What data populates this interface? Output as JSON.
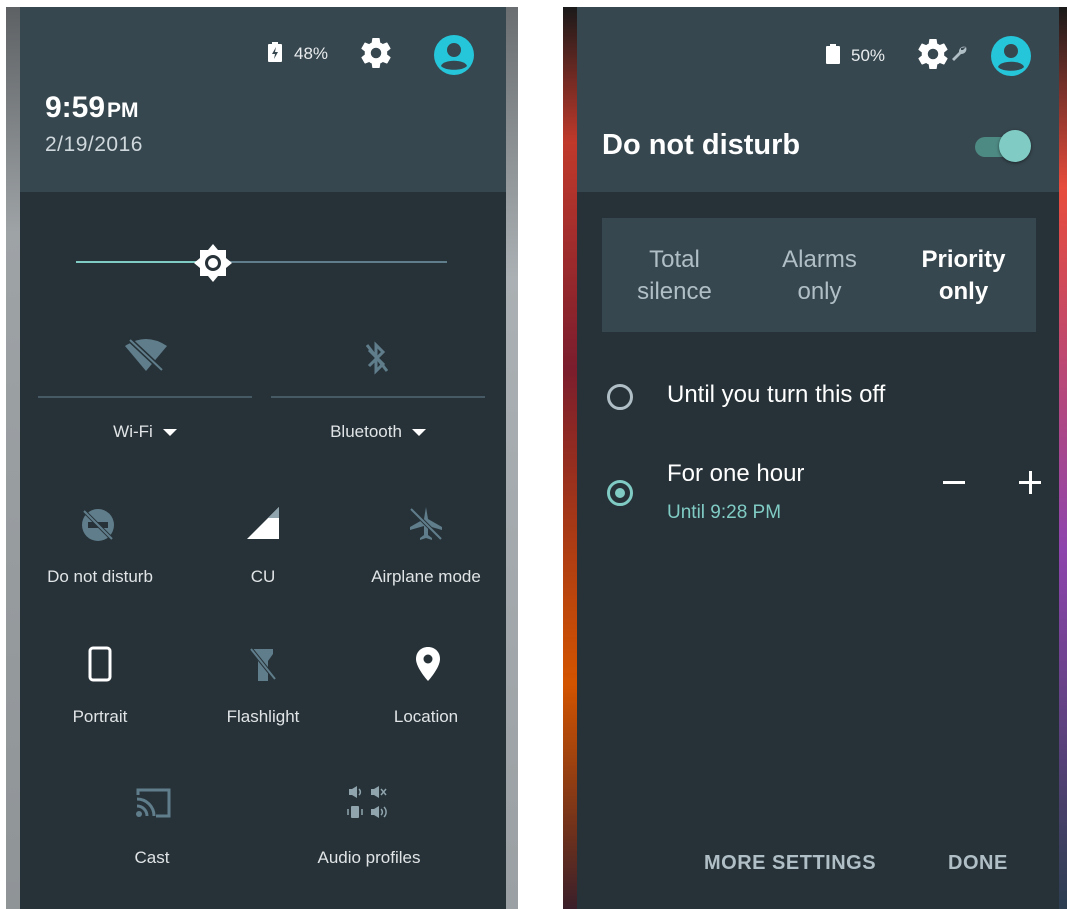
{
  "left_panel": {
    "status": {
      "battery_percent": "48%",
      "battery_icon": "battery-charging-icon",
      "settings_icon": "gear-icon",
      "avatar_icon": "account-icon"
    },
    "clock": {
      "time": "9:59",
      "ampm": "PM"
    },
    "date": "2/19/2016",
    "brightness": {
      "level": 0.37,
      "icon": "brightness-icon"
    },
    "tiles": [
      {
        "label": "Wi-Fi",
        "icon": "wifi-off-icon",
        "dropdown": true
      },
      {
        "label": "Bluetooth",
        "icon": "bluetooth-off-icon",
        "dropdown": true
      },
      {
        "label": "Do not disturb",
        "icon": "do-not-disturb-off-icon"
      },
      {
        "label": "CU",
        "icon": "cell-signal-icon"
      },
      {
        "label": "Airplane mode",
        "icon": "airplane-off-icon"
      },
      {
        "label": "Portrait",
        "icon": "portrait-phone-icon"
      },
      {
        "label": "Flashlight",
        "icon": "flashlight-off-icon"
      },
      {
        "label": "Location",
        "icon": "location-icon"
      },
      {
        "label": "Cast",
        "icon": "cast-icon"
      },
      {
        "label": "Audio profiles",
        "icon": "audio-profiles-icon"
      }
    ]
  },
  "right_panel": {
    "status": {
      "battery_percent": "50%",
      "battery_icon": "battery-icon",
      "settings_icon": "gear-icon",
      "wrench_icon": "wrench-icon",
      "avatar_icon": "account-icon"
    },
    "title": "Do not disturb",
    "toggle_on": true,
    "modes": [
      {
        "line1": "Total",
        "line2": "silence",
        "selected": false
      },
      {
        "line1": "Alarms",
        "line2": "only",
        "selected": false
      },
      {
        "line1": "Priority",
        "line2": "only",
        "selected": true
      }
    ],
    "options": [
      {
        "label": "Until you turn this off",
        "selected": false
      },
      {
        "label": "For one hour",
        "sublabel": "Until 9:28 PM",
        "selected": true
      }
    ],
    "actions": {
      "more_settings": "MORE SETTINGS",
      "done": "DONE"
    },
    "accent_color": "#80cbc4"
  }
}
